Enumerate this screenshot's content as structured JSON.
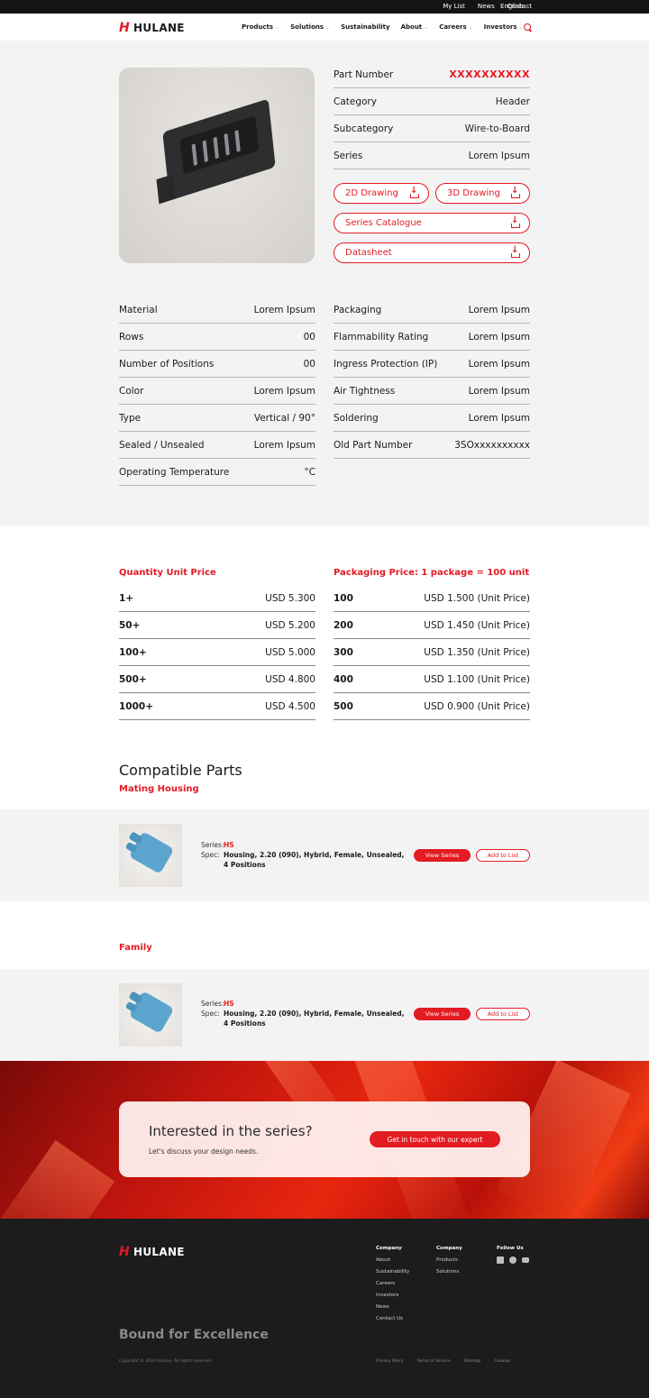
{
  "topbar": {
    "links": [
      "My List",
      "News",
      "Contact"
    ],
    "language": "English"
  },
  "brand": {
    "name": "HULANE",
    "accent": "#e31b23"
  },
  "nav": {
    "items": [
      {
        "label": "Products",
        "dropdown": true
      },
      {
        "label": "Solutions",
        "dropdown": true
      },
      {
        "label": "Sustainability",
        "dropdown": false
      },
      {
        "label": "About",
        "dropdown": true
      },
      {
        "label": "Careers",
        "dropdown": true
      },
      {
        "label": "Investors",
        "dropdown": true
      }
    ]
  },
  "summary": [
    {
      "label": "Part Number",
      "value": "XXXXXXXXXX"
    },
    {
      "label": "Category",
      "value": "Header"
    },
    {
      "label": "Subcategory",
      "value": "Wire-to-Board"
    },
    {
      "label": "Series",
      "value": "Lorem Ipsum"
    }
  ],
  "downloads": {
    "drawing2d": "2D Drawing",
    "drawing3d": "3D Drawing",
    "catalogue": "Series Catalogue",
    "datasheet": "Datasheet"
  },
  "specs_left": [
    {
      "label": "Material",
      "value": "Lorem Ipsum"
    },
    {
      "label": "Rows",
      "value": "00"
    },
    {
      "label": "Number of Positions",
      "value": "00"
    },
    {
      "label": "Color",
      "value": "Lorem Ipsum"
    },
    {
      "label": "Type",
      "value": "Vertical / 90°"
    },
    {
      "label": "Sealed / Unsealed",
      "value": "Lorem Ipsum"
    },
    {
      "label": "Operating Temperature",
      "value": "°C"
    }
  ],
  "specs_right": [
    {
      "label": "Packaging",
      "value": "Lorem Ipsum"
    },
    {
      "label": "Flammability Rating",
      "value": "Lorem Ipsum"
    },
    {
      "label": "Ingress Protection (IP)",
      "value": "Lorem Ipsum"
    },
    {
      "label": "Air Tightness",
      "value": "Lorem Ipsum"
    },
    {
      "label": "Soldering",
      "value": "Lorem Ipsum"
    },
    {
      "label": "Old Part Number",
      "value": "3SOxxxxxxxxxx"
    }
  ],
  "pricing": {
    "quantity_title": "Quantity Unit Price",
    "quantity": [
      {
        "q": "1+",
        "price": "USD 5.300"
      },
      {
        "q": "50+",
        "price": "USD 5.200"
      },
      {
        "q": "100+",
        "price": "USD 5.000"
      },
      {
        "q": "500+",
        "price": "USD 4.800"
      },
      {
        "q": "1000+",
        "price": "USD 4.500"
      }
    ],
    "packaging_title": "Packaging Price: 1 package = 100 unit",
    "packaging": [
      {
        "q": "100",
        "price": "USD 1.500 (Unit Price)"
      },
      {
        "q": "200",
        "price": "USD 1.450 (Unit Price)"
      },
      {
        "q": "300",
        "price": "USD 1.350 (Unit Price)"
      },
      {
        "q": "400",
        "price": "USD 1.100 (Unit Price)"
      },
      {
        "q": "500",
        "price": "USD 0.900 (Unit Price)"
      }
    ]
  },
  "compatible": {
    "title": "Compatible Parts",
    "mating_title": "Mating Housing",
    "family_title": "Family",
    "items": [
      {
        "series_label": "Series:",
        "series": "HS",
        "spec_label": "Spec:",
        "spec_line1": "Housing, 2.20 (090), Hybrid, Female, Unsealed,",
        "spec_line2": "4 Positions",
        "view": "View Series",
        "add": "Add to List"
      },
      {
        "series_label": "Series:",
        "series": "HS",
        "spec_label": "Spec:",
        "spec_line1": "Housing, 2.20 (090), Hybrid, Female, Unsealed,",
        "spec_line2": "4 Positions",
        "view": "View Series",
        "add": "Add to List"
      }
    ]
  },
  "cta": {
    "title": "Interested in the series?",
    "subtitle": "Let's discuss your design needs.",
    "button": "Get in touch with our expert"
  },
  "footer": {
    "col1": {
      "heading": "Company",
      "links": [
        "About",
        "Sustainability",
        "Careers",
        "Investors",
        "News",
        "Contact Us"
      ]
    },
    "col2": {
      "heading": "Company",
      "links": [
        "Products",
        "Solutions"
      ]
    },
    "follow": "Follow Us",
    "tagline": "Bound for Excellence",
    "copyright": "Copyright © 2024 Hulane. All rights reserved.",
    "legal": [
      "Privacy Policy",
      "Terms of Service",
      "Sitemap",
      "Cookies"
    ]
  }
}
